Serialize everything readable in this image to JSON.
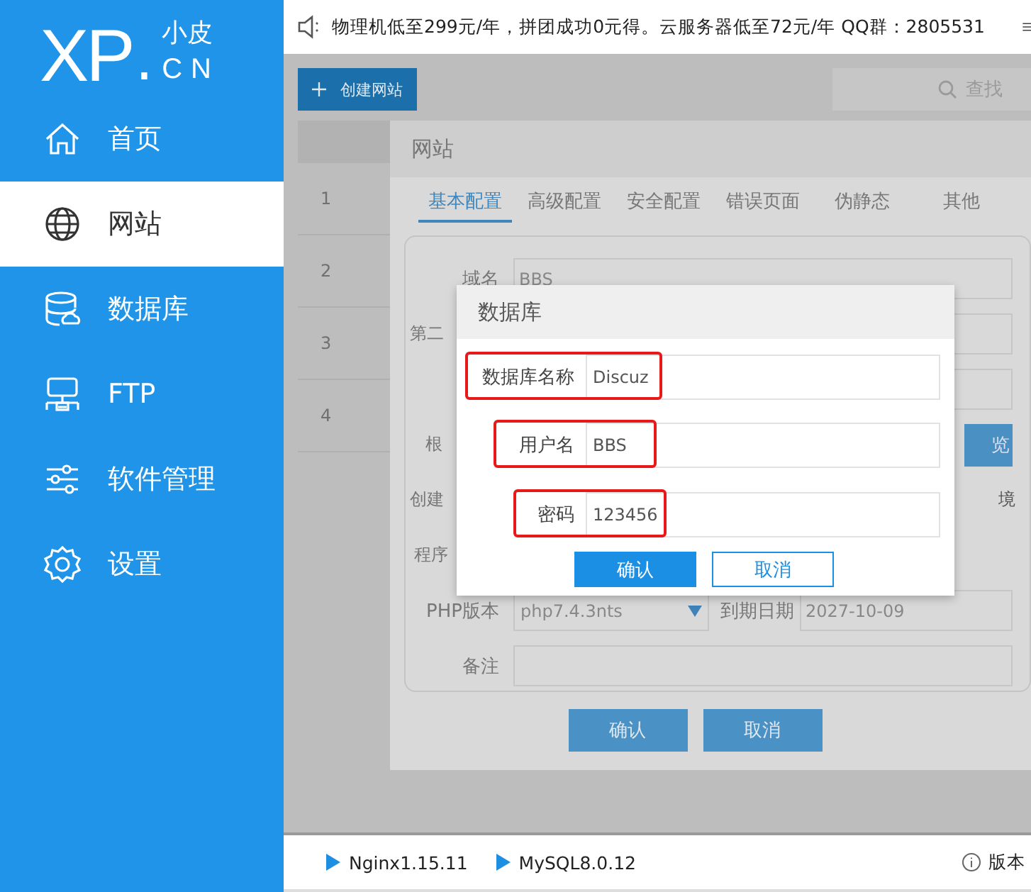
{
  "logo": {
    "mark": "XP",
    "dot": ".",
    "name": "小皮",
    "domain": "CN"
  },
  "sidebar": {
    "items": [
      {
        "label": "首页",
        "selected": false
      },
      {
        "label": "网站",
        "selected": true
      },
      {
        "label": "数据库",
        "selected": false
      },
      {
        "label": "FTP",
        "selected": false
      },
      {
        "label": "软件管理",
        "selected": false
      },
      {
        "label": "设置",
        "selected": false
      }
    ]
  },
  "notice": {
    "text": "物理机低至299元/年，拼团成功0元得。云服务器低至72元/年  QQ群：2805531"
  },
  "toolbar": {
    "create_button": "创建网站",
    "search": {
      "placeholder": "查找"
    }
  },
  "table": {
    "rows": [
      "1",
      "2",
      "3",
      "4"
    ]
  },
  "site_dialog": {
    "title": "网站",
    "tabs": [
      {
        "label": "基本配置",
        "selected": true
      },
      {
        "label": "高级配置",
        "selected": false
      },
      {
        "label": "安全配置",
        "selected": false
      },
      {
        "label": "错误页面",
        "selected": false
      },
      {
        "label": "伪静态",
        "selected": false
      },
      {
        "label": "其他",
        "selected": false
      }
    ],
    "rows": [
      {
        "kind": "text",
        "label": "域名",
        "value": "BBS"
      },
      {
        "kind": "text",
        "label": "第二"
      },
      {
        "kind": "text"
      },
      {
        "kind": "browse",
        "label": "根",
        "button": "览"
      },
      {
        "kind": "note",
        "label": "创建",
        "trailing": "境"
      },
      {
        "kind": "blank",
        "label": "程序"
      },
      {
        "kind": "select-date",
        "label": "PHP版本",
        "value": "php7.4.3nts",
        "label2": "到期日期",
        "value2": "2027-10-09"
      },
      {
        "kind": "text",
        "label": "备注"
      }
    ],
    "buttons": [
      "确认",
      "取消"
    ]
  },
  "db_dialog": {
    "title": "数据库",
    "rows": [
      {
        "label": "数据库名称",
        "value": "Discuz",
        "highlighted": true
      },
      {
        "label": "用户名",
        "value": "BBS",
        "highlighted": true
      },
      {
        "label": "密码",
        "value": "123456",
        "highlighted": true
      }
    ],
    "buttons": [
      "确认",
      "取消"
    ]
  },
  "status_bar": {
    "services": [
      "Nginx1.15.11",
      "MySQL8.0.12"
    ],
    "version_label": "版本"
  }
}
